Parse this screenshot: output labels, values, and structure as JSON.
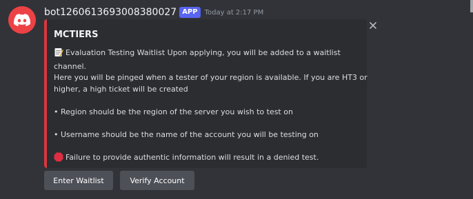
{
  "colors": {
    "background": "#313338",
    "embed_background": "#2b2d31",
    "embed_accent": "#da373c",
    "app_tag": "#5865f2",
    "button": "#4e5058",
    "avatar": "#ed4245"
  },
  "message": {
    "author": "bot1260613693008380027",
    "app_tag": "APP",
    "timestamp": "Today at 2:17 PM",
    "avatar_icon": "discord-logo-icon"
  },
  "embed": {
    "title": "MCTIERS",
    "close_icon": "close-icon",
    "lines": {
      "l1": "Evaluation Testing Waitlist Upon applying, you will be added to a waitlist",
      "l2": "channel.",
      "l3": "Here you will be pinged when a tester of your region is available. If you are HT3 or",
      "l4": "higher, a high ticket will be created",
      "l5": "• Region should be the region of the server you wish to test on",
      "l6": "• Username should be the name of the account you will be testing on",
      "l7": "Failure to provide authentic information will result in a denied test."
    },
    "icons": {
      "memo": "memo-icon",
      "stop": "stop-sign-icon"
    }
  },
  "buttons": {
    "enter_waitlist": "Enter Waitlist",
    "verify_account": "Verify Account"
  }
}
